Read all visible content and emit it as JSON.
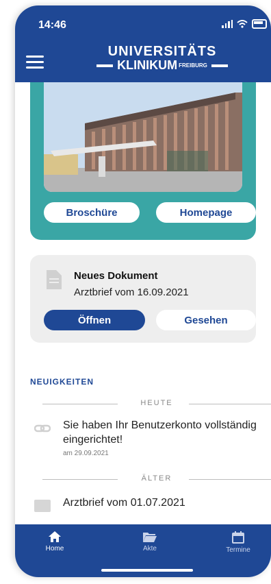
{
  "status": {
    "time": "14:46"
  },
  "header": {
    "logo_line1": "UNIVERSITÄTS",
    "logo_line2": "KLINIKUM",
    "logo_line2_suffix": "FREIBURG"
  },
  "hero": {
    "broschure_label": "Broschüre",
    "homepage_label": "Homepage"
  },
  "document": {
    "title": "Neues Dokument",
    "subtitle": "Arztbrief vom 16.09.2021",
    "open_label": "Öffnen",
    "seen_label": "Gesehen"
  },
  "news": {
    "heading": "NEUIGKEITEN",
    "today_label": "HEUTE",
    "older_label": "ÄLTER",
    "items": [
      {
        "text": "Sie haben Ihr Benutzerkonto vollständig eingerichtet!",
        "date": "am 29.09.2021",
        "icon": "link-icon"
      },
      {
        "text": "Arztbrief vom 01.07.2021",
        "icon": "document-icon"
      }
    ]
  },
  "tabs": [
    {
      "label": "Home",
      "icon": "home-icon",
      "active": true
    },
    {
      "label": "Akte",
      "icon": "folder-icon",
      "active": false
    },
    {
      "label": "Termine",
      "icon": "calendar-icon",
      "active": false
    }
  ],
  "colors": {
    "brand": "#1f4895",
    "hero": "#3aa6a5",
    "card": "#eeeeee"
  }
}
